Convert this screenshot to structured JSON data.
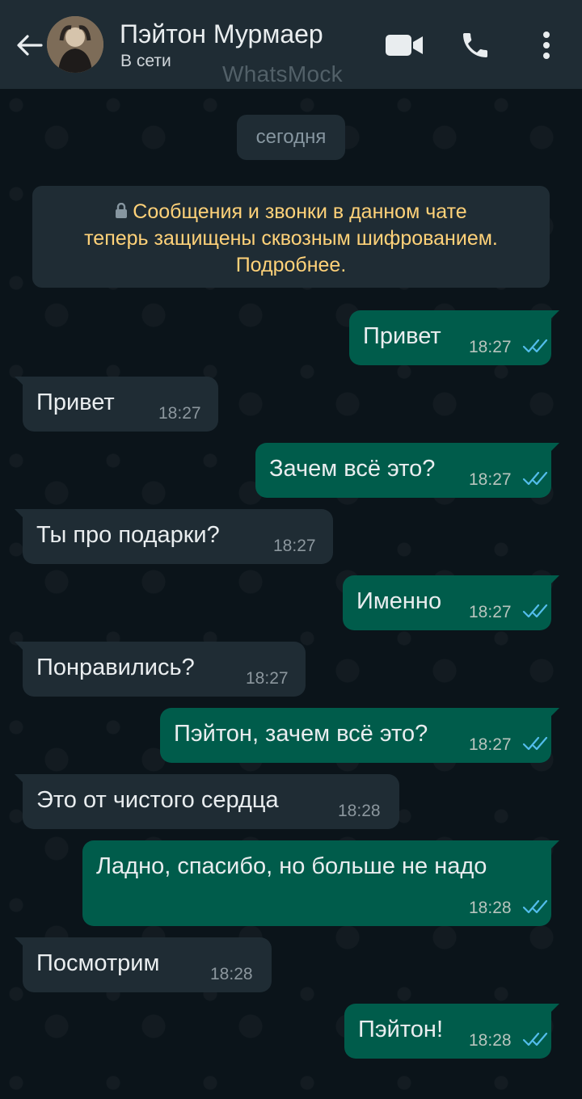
{
  "header": {
    "back_icon": "arrow-left-icon",
    "contact_name": "Пэйтон Мурмаер",
    "status": "В сети",
    "watermark": "WhatsMock",
    "video_icon": "video-camera-icon",
    "call_icon": "phone-icon",
    "menu_icon": "more-vertical-icon"
  },
  "chat": {
    "date_label": "сегодня",
    "encryption_notice": {
      "line1": "Сообщения и звонки в данном чате",
      "line2": "теперь защищены сквозным шифрованием.",
      "line3": "Подробнее."
    },
    "messages": [
      {
        "direction": "out",
        "text": "Привет",
        "time": "18:27",
        "status": "read"
      },
      {
        "direction": "in",
        "text": "Привет",
        "time": "18:27"
      },
      {
        "direction": "out",
        "text": "Зачем всё это?",
        "time": "18:27",
        "status": "read"
      },
      {
        "direction": "in",
        "text": "Ты про подарки?",
        "time": "18:27"
      },
      {
        "direction": "out",
        "text": "Именно",
        "time": "18:27",
        "status": "read"
      },
      {
        "direction": "in",
        "text": "Понравились?",
        "time": "18:27"
      },
      {
        "direction": "out",
        "text": "Пэйтон, зачем всё это?",
        "time": "18:27",
        "status": "read"
      },
      {
        "direction": "in",
        "text": "Это от чистого сердца",
        "time": "18:28"
      },
      {
        "direction": "out",
        "text": "Ладно, спасибо, но больше не надо",
        "time": "18:28",
        "status": "read"
      },
      {
        "direction": "in",
        "text": "Посмотрим",
        "time": "18:28"
      },
      {
        "direction": "out",
        "text": "Пэйтон!",
        "time": "18:28",
        "status": "read"
      }
    ]
  },
  "colors": {
    "header_bg": "#1f2c34",
    "chat_bg": "#0b141a",
    "outgoing_bubble": "#005c4b",
    "incoming_bubble": "#1f2c34",
    "encryption_text": "#ffd279",
    "read_ticks": "#53bdeb"
  }
}
